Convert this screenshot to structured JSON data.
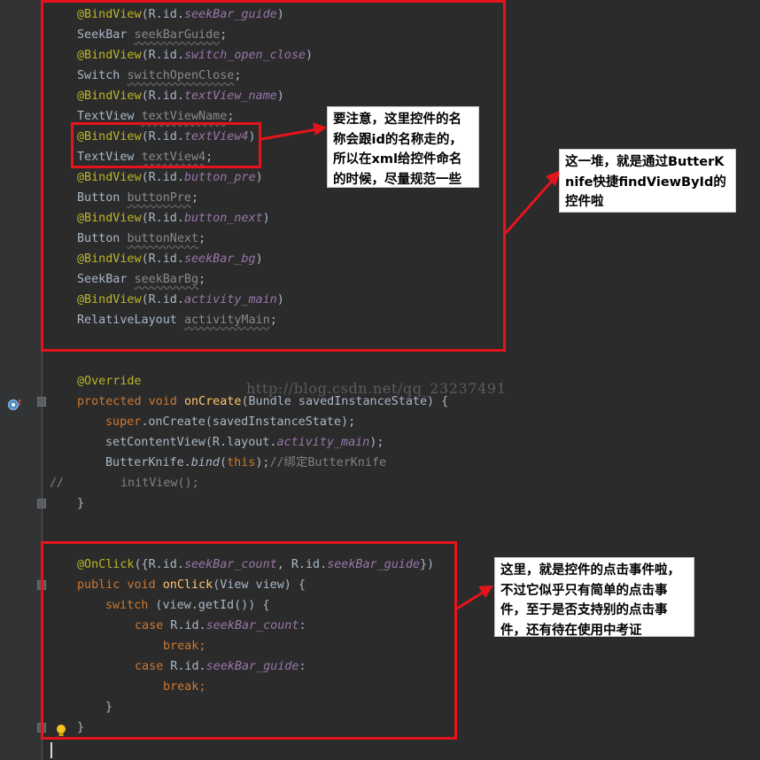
{
  "code": {
    "bind1_id": "seekBar_guide",
    "bind1_type": "SeekBar",
    "bind1_var": "seekBarGuide",
    "bind2_id": "switch_open_close",
    "bind2_type": "Switch",
    "bind2_var": "switchOpenClose",
    "bind3_id": "textView_name",
    "bind3_type": "TextView",
    "bind3_var": "textViewName",
    "bind4_id": "textView4",
    "bind4_type": "TextView",
    "bind4_var": "textView4",
    "bind5_id": "button_pre",
    "bind5_type": "Button",
    "bind5_var": "buttonPre",
    "bind6_id": "button_next",
    "bind6_type": "Button",
    "bind6_var": "buttonNext",
    "bind7_id": "seekBar_bg",
    "bind7_type": "SeekBar",
    "bind7_var": "seekBarBg",
    "bind8_id": "activity_main",
    "bind8_type": "RelativeLayout",
    "bind8_var": "activityMain",
    "bind_annotation": "@BindView",
    "rid": "R.id.",
    "override": "@Override",
    "protected": "protected",
    "void": "void",
    "oncreate_name": "onCreate",
    "oncreate_params": "(Bundle savedInstanceState) {",
    "super_kw": "super",
    "super_call": ".onCreate(savedInstanceState);",
    "setcontent_pre": "setContentView(R.layout.",
    "setcontent_field": "activity_main",
    "setcontent_post": ");",
    "bk_pre": "ButterKnife.",
    "bk_method": "bind",
    "bk_open": "(",
    "bk_this": "this",
    "bk_close": ");",
    "bk_comment": "//绑定ButterKnife",
    "comment_slashes": "//",
    "initview": "initView();",
    "close_brace": "}",
    "onclick_annotation": "@OnClick",
    "onclick_open": "({R.id.",
    "onclick_field1": "seekBar_count",
    "onclick_sep": ", R.id.",
    "onclick_field2": "seekBar_guide",
    "onclick_close": "})",
    "public": "public",
    "onclick_name": "onClick",
    "onclick_params": "(View view) {",
    "switch_kw": "switch",
    "switch_expr": " (view.getId()) {",
    "case_kw": "case",
    "case_rid": " R.id.",
    "case1_field": "seekBar_count",
    "case2_field": "seekBar_guide",
    "colon": ":",
    "break_kw": "break",
    "semicolon": ";"
  },
  "watermark": "http://blog.csdn.net/qq_23237491",
  "notes": {
    "note1": "要注意，这里控件的名称会跟id的名称走的，所以在xml给控件命名的时候，尽量规范一些",
    "note2": "这一堆，就是通过ButterKnife快捷findViewById的控件啦",
    "note3": "这里，就是控件的点击事件啦，不过它似乎只有简单的点击事件，至于是否支持别的点击事件，还有待在使用中考证"
  },
  "colors": {
    "editor_bg": "#2b2b2b",
    "annotation": "#bbb529",
    "keyword": "#cc7832",
    "field": "#9876aa",
    "method": "#ffc66d",
    "comment": "#808080",
    "highlight_border": "#e5141b"
  },
  "icons": [
    "override-gutter-icon",
    "fold-marker-icon",
    "lightbulb-icon",
    "arrow-icon"
  ]
}
